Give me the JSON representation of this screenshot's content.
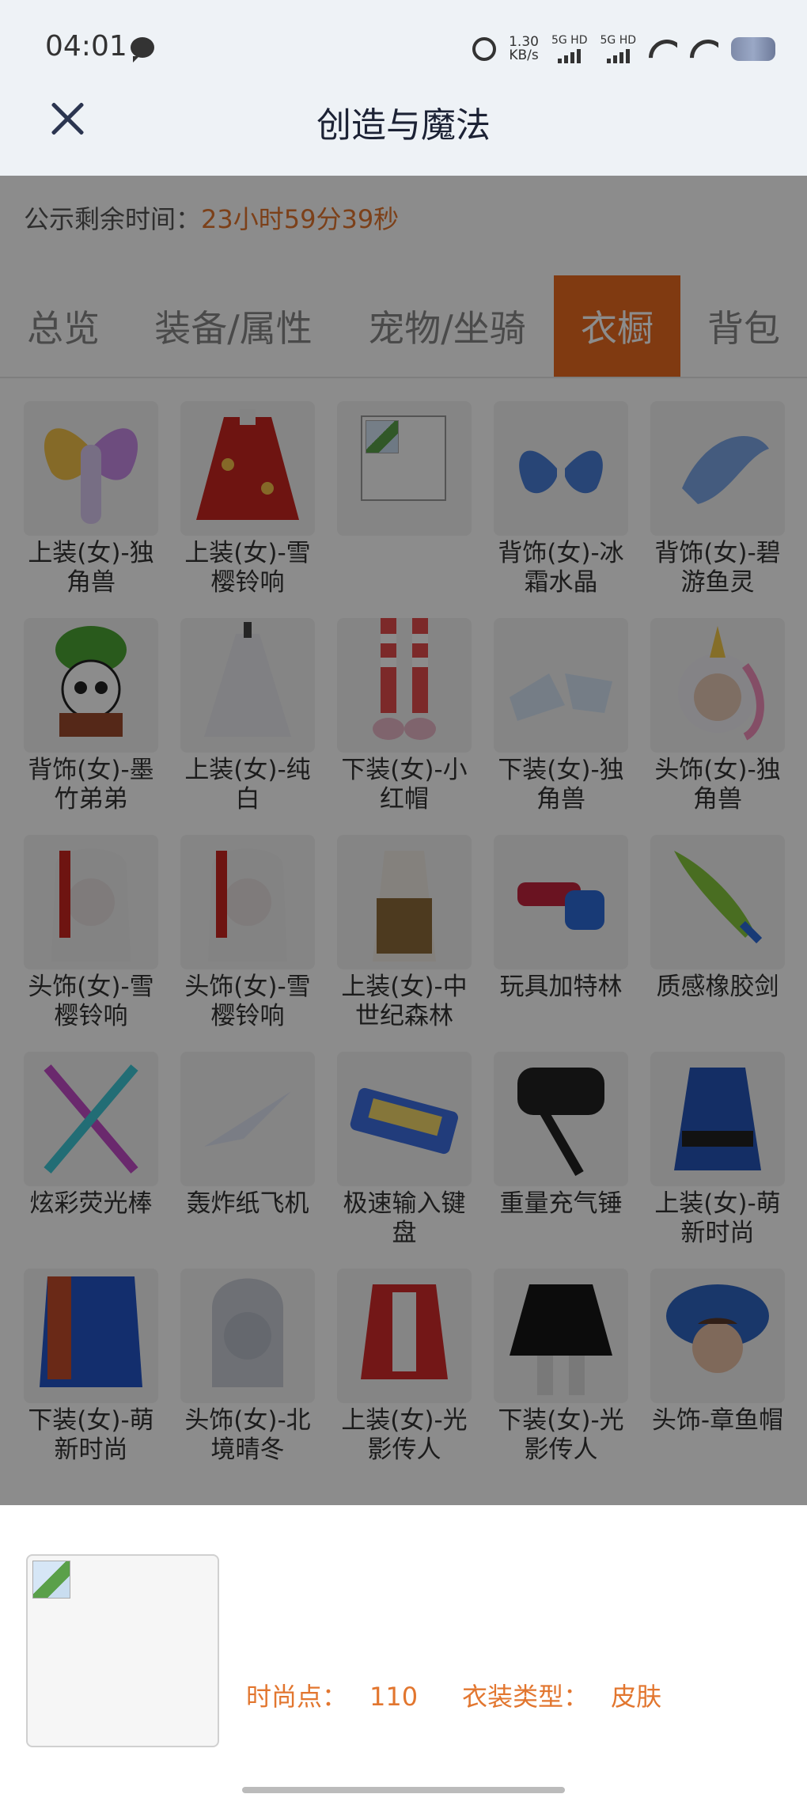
{
  "status_bar": {
    "time": "04:01",
    "net_rate": "1.30",
    "net_unit": "KB/s",
    "sim1": "5G HD",
    "sim2": "5G HD"
  },
  "header": {
    "title": "创造与魔法"
  },
  "notice": {
    "label": "公示剩余时间：",
    "value": "23小时59分39秒"
  },
  "tabs": [
    {
      "label": "总览",
      "active": false
    },
    {
      "label": "装备/属性",
      "active": false
    },
    {
      "label": "宠物/坐骑",
      "active": false
    },
    {
      "label": "衣橱",
      "active": true
    },
    {
      "label": "背包",
      "active": false
    }
  ],
  "items": [
    {
      "name": "上装(女)-独角兽",
      "thumb": "wings-rainbow"
    },
    {
      "name": "上装(女)-雪樱铃响",
      "thumb": "red-kimono"
    },
    {
      "name": "",
      "thumb": "broken-image"
    },
    {
      "name": "背饰(女)-冰霜水晶",
      "thumb": "ice-wings"
    },
    {
      "name": "背饰(女)-碧游鱼灵",
      "thumb": "fish-fins"
    },
    {
      "name": "背饰(女)-墨竹弟弟",
      "thumb": "panda"
    },
    {
      "name": "上装(女)-纯白",
      "thumb": "white-dress"
    },
    {
      "name": "下装(女)-小红帽",
      "thumb": "striped-legs"
    },
    {
      "name": "下装(女)-独角兽",
      "thumb": "white-shoes"
    },
    {
      "name": "头饰(女)-独角兽",
      "thumb": "unicorn-hood"
    },
    {
      "name": "头饰(女)-雪樱铃响",
      "thumb": "white-hair"
    },
    {
      "name": "头饰(女)-雪樱铃响",
      "thumb": "white-hair"
    },
    {
      "name": "上装(女)-中世纪森林",
      "thumb": "medieval-outfit"
    },
    {
      "name": "玩具加特林",
      "thumb": "toy-gatling"
    },
    {
      "name": "质感橡胶剑",
      "thumb": "rubber-sword"
    },
    {
      "name": "炫彩荧光棒",
      "thumb": "glow-sticks"
    },
    {
      "name": "轰炸纸飞机",
      "thumb": "paper-plane"
    },
    {
      "name": "极速输入键盘",
      "thumb": "keyboard"
    },
    {
      "name": "重量充气锤",
      "thumb": "hammer"
    },
    {
      "name": "上装(女)-萌新时尚",
      "thumb": "blue-top"
    },
    {
      "name": "下装(女)-萌新时尚",
      "thumb": "blue-skirt"
    },
    {
      "name": "头饰(女)-北境晴冬",
      "thumb": "silver-hair"
    },
    {
      "name": "上装(女)-光影传人",
      "thumb": "red-jacket"
    },
    {
      "name": "下装(女)-光影传人",
      "thumb": "black-skirt"
    },
    {
      "name": "头饰-章鱼帽",
      "thumb": "octopus-hat"
    }
  ],
  "sheet": {
    "fashion_label": "时尚点：",
    "fashion_value": "110",
    "type_label": "衣装类型：",
    "type_value": "皮肤"
  },
  "colors": {
    "accent": "#e96a1f",
    "accent_text": "#e2762f",
    "header_bg": "#eef2f6"
  }
}
